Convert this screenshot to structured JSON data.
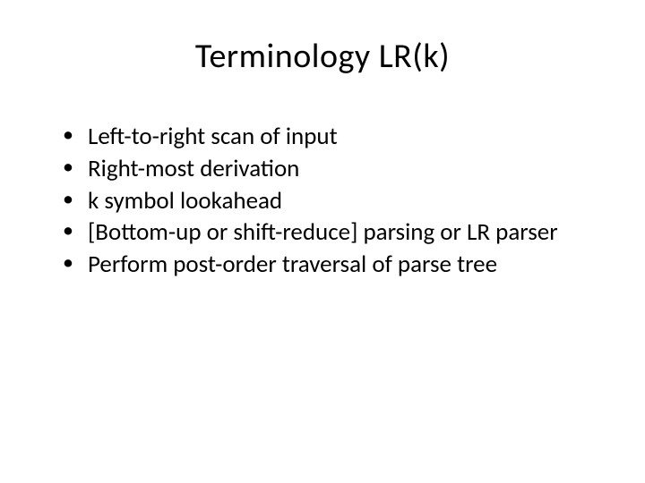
{
  "slide": {
    "title": "Terminology LR(k)",
    "bullets": [
      "Left-to-right scan of input",
      "Right-most derivation",
      "k symbol lookahead",
      "[Bottom-up or shift-reduce] parsing or LR parser",
      "Perform post-order traversal of parse tree"
    ]
  }
}
